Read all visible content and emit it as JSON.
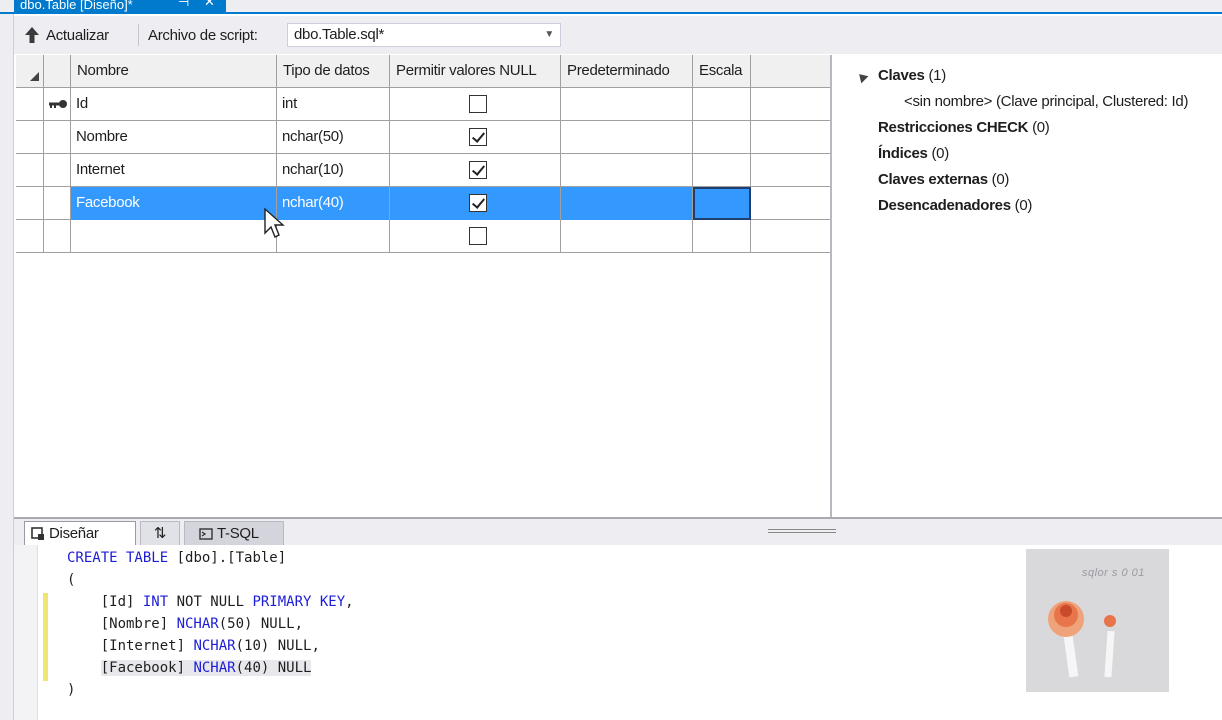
{
  "document_tab": {
    "title": "dbo.Table [Diseño]*",
    "pin_glyph": "⊣",
    "close_glyph": "✕"
  },
  "toolbar": {
    "update_label": "Actualizar",
    "script_label": "Archivo de script:",
    "script_file": "dbo.Table.sql*"
  },
  "grid": {
    "columns": [
      "Nombre",
      "Tipo de datos",
      "Permitir valores NULL",
      "Predeterminado",
      "Escala"
    ],
    "rows": [
      {
        "name": "Id",
        "type": "int",
        "allow_null": false,
        "primary_key": true
      },
      {
        "name": "Nombre",
        "type": "nchar(50)",
        "allow_null": true
      },
      {
        "name": "Internet",
        "type": "nchar(10)",
        "allow_null": true
      },
      {
        "name": "Facebook",
        "type": "nchar(40)",
        "allow_null": true,
        "selected": true
      },
      {
        "name": "",
        "type": "",
        "allow_null": false
      }
    ]
  },
  "properties": {
    "keys_label": "Claves",
    "keys_count": "(1)",
    "key_item": "<sin nombre>  (Clave principal, Clustered: Id)",
    "check_label": "Restricciones CHECK",
    "check_count": "(0)",
    "indexes_label": "Índices",
    "indexes_count": "(0)",
    "fk_label": "Claves externas",
    "fk_count": "(0)",
    "triggers_label": "Desencadenadores",
    "triggers_count": "(0)"
  },
  "pane_tabs": {
    "design": "Diseñar",
    "swap": "⇅",
    "tsql": "T-SQL"
  },
  "code": {
    "l1_kw": "CREATE TABLE",
    "l1_rest": " [dbo].[Table]",
    "l2": "(",
    "l3_name": "    [Id] ",
    "l3_type": "INT",
    "l3_notnull": " NOT NULL ",
    "l3_pk": "PRIMARY KEY",
    "l3_end": ",",
    "l4_name": "    [Nombre] ",
    "l4_type": "NCHAR",
    "l4_rest": "(50) NULL,",
    "l5_name": "    [Internet] ",
    "l5_type": "NCHAR",
    "l5_rest": "(10) NULL,",
    "l6_name": "[Facebook] ",
    "l6_type": "NCHAR",
    "l6_rest": "(40) NULL",
    "l7": ")"
  },
  "watermark": {
    "text": "sqlor s 0 01"
  },
  "colors": {
    "accent": "#007acc",
    "selection": "#3399ff",
    "keyword": "#1d1dd6"
  },
  "icons": [
    "up-arrow-icon",
    "dropdown-arrow-icon",
    "sort-triangle-icon",
    "primary-key-icon",
    "checkbox-icon",
    "mouse-cursor-icon",
    "collapse-triangle-icon",
    "design-icon",
    "swap-icon",
    "tsql-icon"
  ]
}
